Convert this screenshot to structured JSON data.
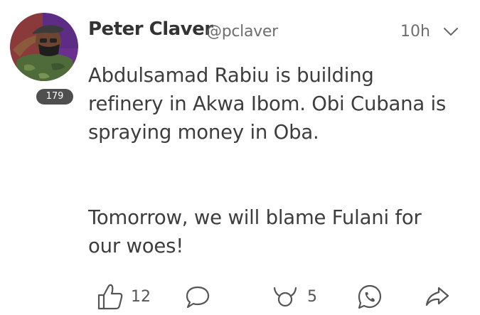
{
  "post": {
    "author": {
      "display_name": "Peter Claver",
      "handle": "@pclaver",
      "badge": "179"
    },
    "time": "10h",
    "paragraphs": [
      "Abdulsamad Rabiu is building\nrefinery in Akwa Ibom. Obi Cubana is\nspraying money in Oba.",
      "Tomorrow, we will blame Fulani for\nour woes!"
    ],
    "actions": {
      "like_count": "12",
      "reply_count": "",
      "boost_count": "5"
    }
  },
  "icons": {
    "menu": "chevron-down-icon",
    "like": "thumbs-up-icon",
    "reply": "speech-bubble-icon",
    "boost": "horns-icon",
    "whatsapp": "whatsapp-icon",
    "share": "share-arrow-icon"
  },
  "colors": {
    "icon_stroke": "#555555",
    "badge_bg": "#4f4f4f"
  }
}
